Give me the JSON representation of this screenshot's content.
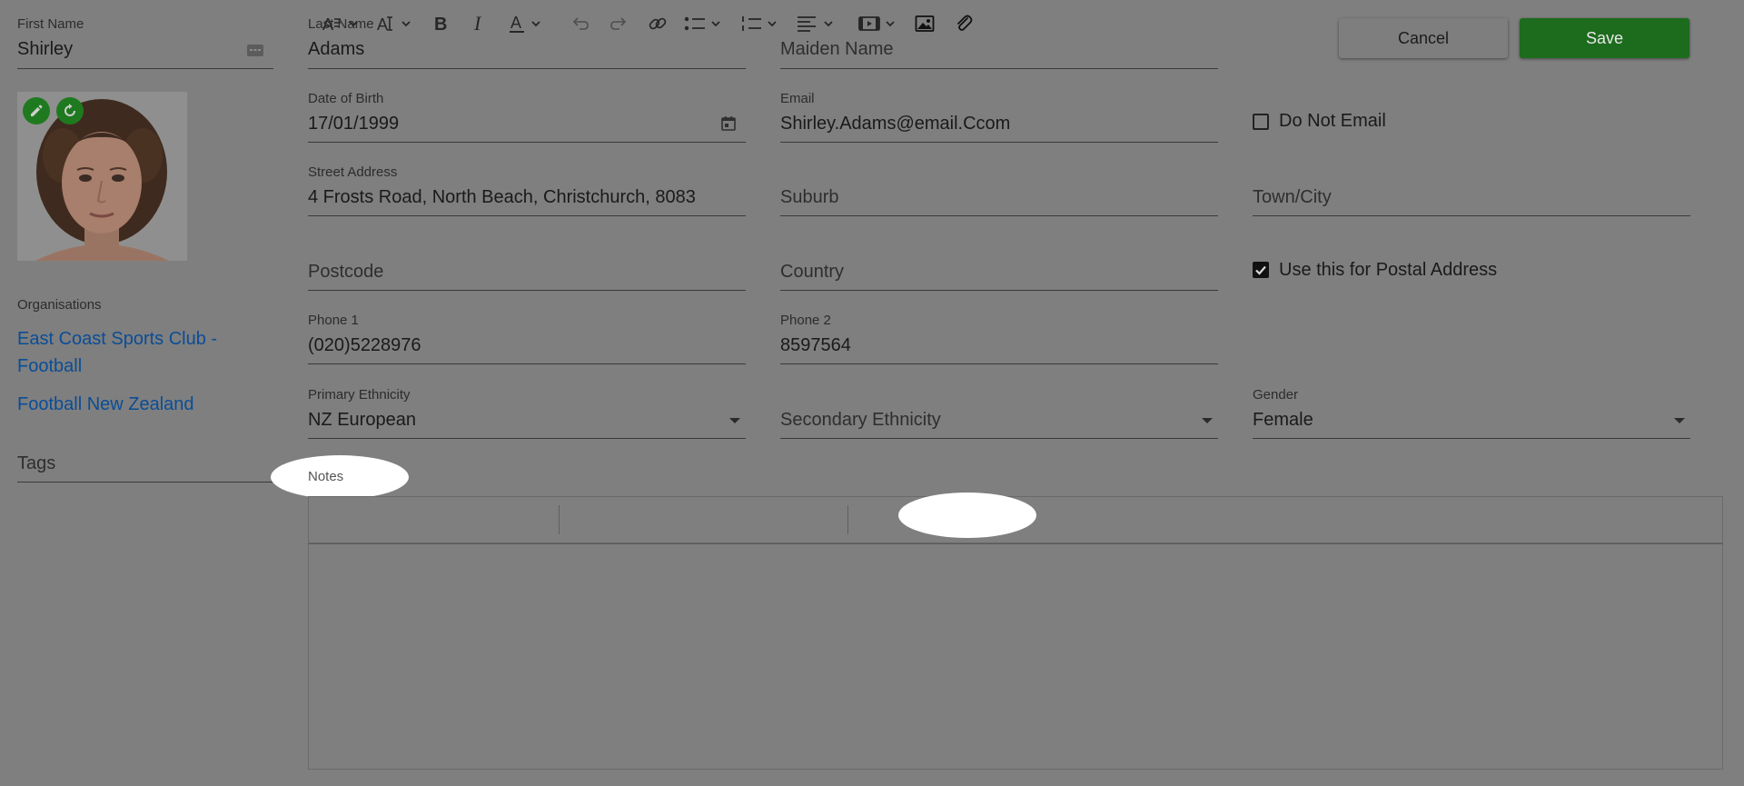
{
  "form": {
    "first_name": {
      "label": "First Name",
      "value": "Shirley"
    },
    "last_name": {
      "label": "Last Name",
      "value": "Adams"
    },
    "maiden_name": {
      "placeholder": "Maiden Name"
    },
    "dob": {
      "label": "Date of Birth",
      "value": "17/01/1999"
    },
    "email": {
      "label": "Email",
      "value": "Shirley.Adams@email.Ccom"
    },
    "do_not_email": {
      "label": "Do Not Email",
      "checked": false
    },
    "street": {
      "label": "Street Address",
      "value": "4 Frosts Road, North Beach, Christchurch, 8083"
    },
    "suburb": {
      "placeholder": "Suburb"
    },
    "town": {
      "placeholder": "Town/City"
    },
    "postcode": {
      "placeholder": "Postcode"
    },
    "country": {
      "placeholder": "Country"
    },
    "postal": {
      "label": "Use this for Postal Address",
      "checked": true
    },
    "phone1": {
      "label": "Phone 1",
      "value": "(020)5228976"
    },
    "phone2": {
      "label": "Phone 2",
      "value": "8597564"
    },
    "primary_ethnicity": {
      "label": "Primary Ethnicity",
      "value": "NZ European"
    },
    "secondary_ethnicity": {
      "placeholder": "Secondary Ethnicity"
    },
    "gender": {
      "label": "Gender",
      "value": "Female"
    },
    "tags": {
      "placeholder": "Tags"
    },
    "notes": {
      "label": "Notes"
    }
  },
  "actions": {
    "cancel": "Cancel",
    "save": "Save"
  },
  "organisations": {
    "heading": "Organisations",
    "items": [
      "East Coast Sports Club - Football",
      "Football New Zealand"
    ]
  },
  "toolbar_icons": [
    "font-family-icon",
    "font-size-icon",
    "bold-icon",
    "italic-icon",
    "font-color-icon",
    "undo-icon",
    "redo-icon",
    "link-icon",
    "bulleted-list-icon",
    "numbered-list-icon",
    "align-icon",
    "media-icon",
    "image-icon",
    "attachment-icon"
  ],
  "colors": {
    "save": "#1d6b1d",
    "link": "#0a4d96",
    "avatar_action": "#1f7a1f"
  }
}
